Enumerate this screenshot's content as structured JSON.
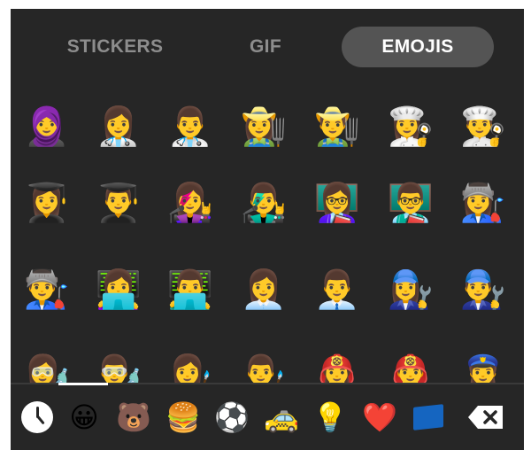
{
  "tabs": [
    {
      "label": "STICKERS",
      "active": false
    },
    {
      "label": "GIF",
      "active": false
    },
    {
      "label": "EMOJIS",
      "active": true
    }
  ],
  "emoji_grid": [
    [
      "🧕",
      "👩‍⚕️",
      "👨‍⚕️",
      "👩‍🌾",
      "👨‍🌾",
      "👩‍🍳",
      "👨‍🍳"
    ],
    [
      "👩‍🎓",
      "👨‍🎓",
      "👩‍🎤",
      "👨‍🎤",
      "👩‍🏫",
      "👨‍🏫",
      "👩‍🏭"
    ],
    [
      "👨‍🏭",
      "👩‍💻",
      "👨‍💻",
      "👩‍💼",
      "👨‍💼",
      "👩‍🔧",
      "👨‍🔧"
    ],
    [
      "👩‍🔬",
      "👨‍🔬",
      "👩‍🎨",
      "👨‍🎨",
      "👩‍🚒",
      "👨‍🚒",
      "👮‍♀️"
    ]
  ],
  "categories": [
    {
      "name": "recent",
      "icon": "clock-icon",
      "glyph": "",
      "selected": true
    },
    {
      "name": "smileys",
      "icon": "smiley-icon",
      "glyph": "😀"
    },
    {
      "name": "animals",
      "icon": "bear-icon",
      "glyph": "🐻"
    },
    {
      "name": "food",
      "icon": "hamburger-icon",
      "glyph": "🍔"
    },
    {
      "name": "activities",
      "icon": "soccer-ball-icon",
      "glyph": "⚽"
    },
    {
      "name": "travel",
      "icon": "taxi-icon",
      "glyph": "🚕"
    },
    {
      "name": "objects",
      "icon": "light-bulb-icon",
      "glyph": "💡"
    },
    {
      "name": "symbols",
      "icon": "heart-icon",
      "glyph": "❤️"
    },
    {
      "name": "flags",
      "icon": "flag-icon",
      "glyph": ""
    },
    {
      "name": "delete",
      "icon": "backspace-icon",
      "glyph": ""
    }
  ],
  "colors": {
    "panel_bg": "#262626",
    "active_tab_bg": "#545454",
    "inactive_tab_text": "#8d8d8d",
    "active_tab_text": "#ffffff",
    "indicator": "#ffffff"
  }
}
